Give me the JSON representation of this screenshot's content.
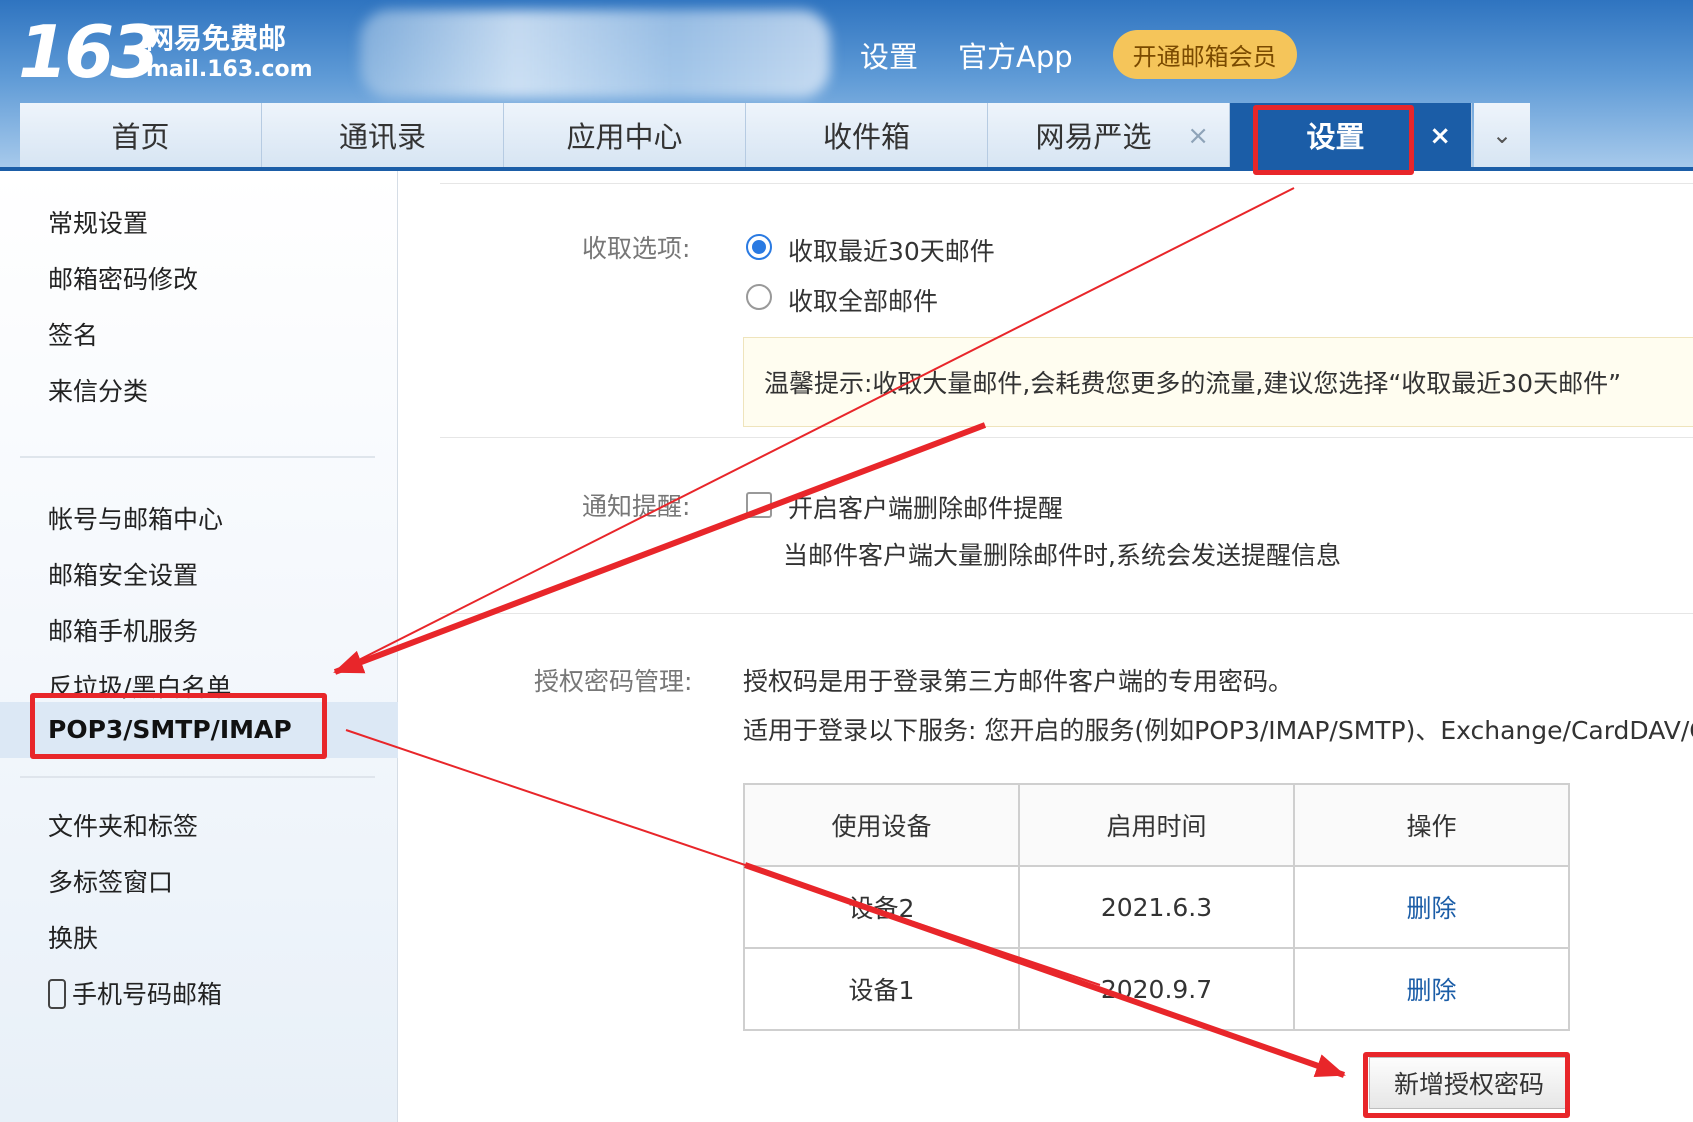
{
  "header": {
    "logo_number": "163",
    "logo_name": "网易免费邮",
    "logo_url": "mail.163.com",
    "links": {
      "settings": "设置",
      "app": "官方App"
    },
    "vip_button": "开通邮箱会员"
  },
  "tabs": [
    {
      "label": "首页"
    },
    {
      "label": "通讯录"
    },
    {
      "label": "应用中心"
    },
    {
      "label": "收件箱"
    },
    {
      "label": "网易严选",
      "close": "×"
    },
    {
      "label": "设置",
      "close": "×",
      "active": true
    }
  ],
  "tab_more_icon": "chevron-down-icon",
  "sidebar": {
    "group1": [
      "常规设置",
      "邮箱密码修改",
      "签名",
      "来信分类"
    ],
    "group2": [
      "帐号与邮箱中心",
      "邮箱安全设置",
      "邮箱手机服务",
      "反垃圾/黑白名单"
    ],
    "active": "POP3/SMTP/IMAP",
    "group3": [
      "文件夹和标签",
      "多标签窗口",
      "换肤"
    ],
    "phone_mailbox": "手机号码邮箱"
  },
  "main": {
    "fetch_label": "收取选项:",
    "fetch_options": [
      {
        "label": "收取最近30天邮件",
        "checked": true
      },
      {
        "label": "收取全部邮件",
        "checked": false
      }
    ],
    "tip": "温馨提示:收取大量邮件,会耗费您更多的流量,建议您选择“收取最近30天邮件”",
    "notify_label": "通知提醒:",
    "notify_checkbox": "开启客户端删除邮件提醒",
    "notify_desc": "当邮件客户端大量删除邮件时,系统会发送提醒信息",
    "auth_label": "授权密码管理:",
    "auth_desc1": "授权码是用于登录第三方邮件客户端的专用密码。",
    "auth_desc2": "适用于登录以下服务: 您开启的服务(例如POP3/IMAP/SMTP)、Exchange/CardDAV/C",
    "table": {
      "headers": [
        "使用设备",
        "启用时间",
        "操作"
      ],
      "rows": [
        [
          "设备2",
          "2021.6.3",
          "删除"
        ],
        [
          "设备1",
          "2020.9.7",
          "删除"
        ]
      ]
    },
    "new_button": "新增授权密码"
  },
  "annotation_color": "#e8262a"
}
